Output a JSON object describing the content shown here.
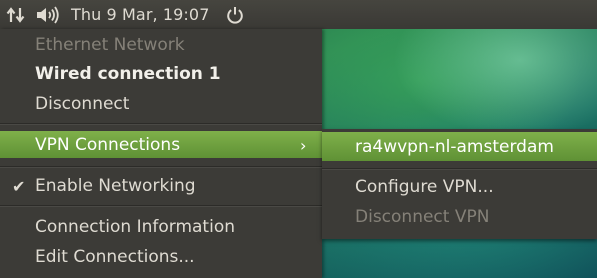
{
  "panel": {
    "network_icon": "network-arrows-icon",
    "volume_icon": "speaker-icon",
    "clock": "Thu  9 Mar, 19:07",
    "power_icon": "power-icon"
  },
  "menu": {
    "items": [
      {
        "label": "Ethernet Network",
        "state": "disabled"
      },
      {
        "label": "Wired connection 1",
        "state": "active-connection"
      },
      {
        "label": "Disconnect",
        "state": "normal"
      },
      {
        "label": "VPN Connections",
        "state": "highlighted",
        "submenu_arrow": "›"
      },
      {
        "label": "Enable Networking",
        "state": "checked",
        "check": "✔"
      },
      {
        "label": "Connection Information",
        "state": "normal"
      },
      {
        "label": "Edit Connections...",
        "state": "normal"
      }
    ]
  },
  "submenu": {
    "items": [
      {
        "label": "ra4wvpn-nl-amsterdam",
        "state": "highlighted"
      },
      {
        "label": "Configure VPN...",
        "state": "normal"
      },
      {
        "label": "Disconnect VPN",
        "state": "disabled"
      }
    ]
  },
  "colors": {
    "menu_bg": "#3c3b37",
    "highlight": "#6fa040",
    "text": "#dfdbd2",
    "disabled_text": "#858178"
  }
}
